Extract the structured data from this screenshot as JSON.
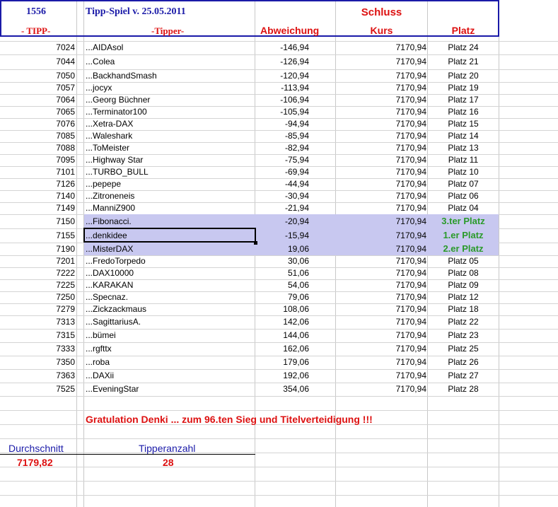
{
  "header": {
    "tipp_id": "1556",
    "game_title": "Tipp-Spiel v. 25.05.2011",
    "schluss": "Schluss",
    "col_tipp": "- TIPP-",
    "col_tipper": "-Tipper-",
    "col_abweichung": "Abweichung",
    "col_kurs": "Kurs",
    "col_platz": "Platz"
  },
  "rows": [
    {
      "tipp": "7024",
      "name": "...AIDAsol",
      "abw": "-146,94",
      "kurs": "7170,94",
      "platz": "Platz 24"
    },
    {
      "tipp": "7044",
      "name": "...Colea",
      "abw": "-126,94",
      "kurs": "7170,94",
      "platz": "Platz 21"
    },
    {
      "tipp": "7050",
      "name": "...BackhandSmash",
      "abw": "-120,94",
      "kurs": "7170,94",
      "platz": "Platz 20"
    },
    {
      "tipp": "7057",
      "name": "...jocyx",
      "abw": "-113,94",
      "kurs": "7170,94",
      "platz": "Platz 19"
    },
    {
      "tipp": "7064",
      "name": "...Georg Büchner",
      "abw": "-106,94",
      "kurs": "7170,94",
      "platz": "Platz 17"
    },
    {
      "tipp": "7065",
      "name": "...Terminator100",
      "abw": "-105,94",
      "kurs": "7170,94",
      "platz": "Platz 16"
    },
    {
      "tipp": "7076",
      "name": "...Xetra-DAX",
      "abw": "-94,94",
      "kurs": "7170,94",
      "platz": "Platz 15"
    },
    {
      "tipp": "7085",
      "name": "...Waleshark",
      "abw": "-85,94",
      "kurs": "7170,94",
      "platz": "Platz 14"
    },
    {
      "tipp": "7088",
      "name": "...ToMeister",
      "abw": "-82,94",
      "kurs": "7170,94",
      "platz": "Platz 13"
    },
    {
      "tipp": "7095",
      "name": "...Highway Star",
      "abw": "-75,94",
      "kurs": "7170,94",
      "platz": "Platz 11"
    },
    {
      "tipp": "7101",
      "name": "...TURBO_BULL",
      "abw": "-69,94",
      "kurs": "7170,94",
      "platz": "Platz 10"
    },
    {
      "tipp": "7126",
      "name": "...pepepe",
      "abw": "-44,94",
      "kurs": "7170,94",
      "platz": "Platz 07"
    },
    {
      "tipp": "7140",
      "name": "...Zitroneneis",
      "abw": "-30,94",
      "kurs": "7170,94",
      "platz": "Platz 06"
    },
    {
      "tipp": "7149",
      "name": "...ManniZ900",
      "abw": "-21,94",
      "kurs": "7170,94",
      "platz": "Platz 04"
    },
    {
      "tipp": "7150",
      "name": "...Fibonacci.",
      "abw": "-20,94",
      "kurs": "7170,94",
      "platz": "3.ter Platz"
    },
    {
      "tipp": "7155",
      "name": "...denkidee",
      "abw": "-15,94",
      "kurs": "7170,94",
      "platz": "1.er Platz"
    },
    {
      "tipp": "7190",
      "name": "...MisterDAX",
      "abw": "19,06",
      "kurs": "7170,94",
      "platz": "2.er Platz"
    },
    {
      "tipp": "7201",
      "name": "...FredoTorpedo",
      "abw": "30,06",
      "kurs": "7170,94",
      "platz": "Platz 05"
    },
    {
      "tipp": "7222",
      "name": "...DAX10000",
      "abw": "51,06",
      "kurs": "7170,94",
      "platz": "Platz 08"
    },
    {
      "tipp": "7225",
      "name": "...KARAKAN",
      "abw": "54,06",
      "kurs": "7170,94",
      "platz": "Platz 09"
    },
    {
      "tipp": "7250",
      "name": "...Specnaz.",
      "abw": "79,06",
      "kurs": "7170,94",
      "platz": "Platz 12"
    },
    {
      "tipp": "7279",
      "name": "...Zickzackmaus",
      "abw": "108,06",
      "kurs": "7170,94",
      "platz": "Platz 18"
    },
    {
      "tipp": "7313",
      "name": "...SagittariusA.",
      "abw": "142,06",
      "kurs": "7170,94",
      "platz": "Platz 22"
    },
    {
      "tipp": "7315",
      "name": "...bümei",
      "abw": "144,06",
      "kurs": "7170,94",
      "platz": "Platz 23"
    },
    {
      "tipp": "7333",
      "name": "...rgfttx",
      "abw": "162,06",
      "kurs": "7170,94",
      "platz": "Platz 25"
    },
    {
      "tipp": "7350",
      "name": "...roba",
      "abw": "179,06",
      "kurs": "7170,94",
      "platz": "Platz 26"
    },
    {
      "tipp": "7363",
      "name": "...DAXii",
      "abw": "192,06",
      "kurs": "7170,94",
      "platz": "Platz 27"
    },
    {
      "tipp": "7525",
      "name": "...EveningStar",
      "abw": "354,06",
      "kurs": "7170,94",
      "platz": "Platz 28"
    }
  ],
  "congrats": "Gratulation Denki ...  zum 96.ten Sieg und Titelverteidigung !!!",
  "summary": {
    "durchschnitt_label": "Durchschnitt",
    "durchschnitt_value": "7179,82",
    "tipperanzahl_label": "Tipperanzahl",
    "tipperanzahl_value": "28"
  },
  "colors": {
    "header_blue": "#1a1aa8",
    "header_red": "#dd1111",
    "highlight": "#c8c8f0",
    "winner_green": "#2a9a2a"
  }
}
